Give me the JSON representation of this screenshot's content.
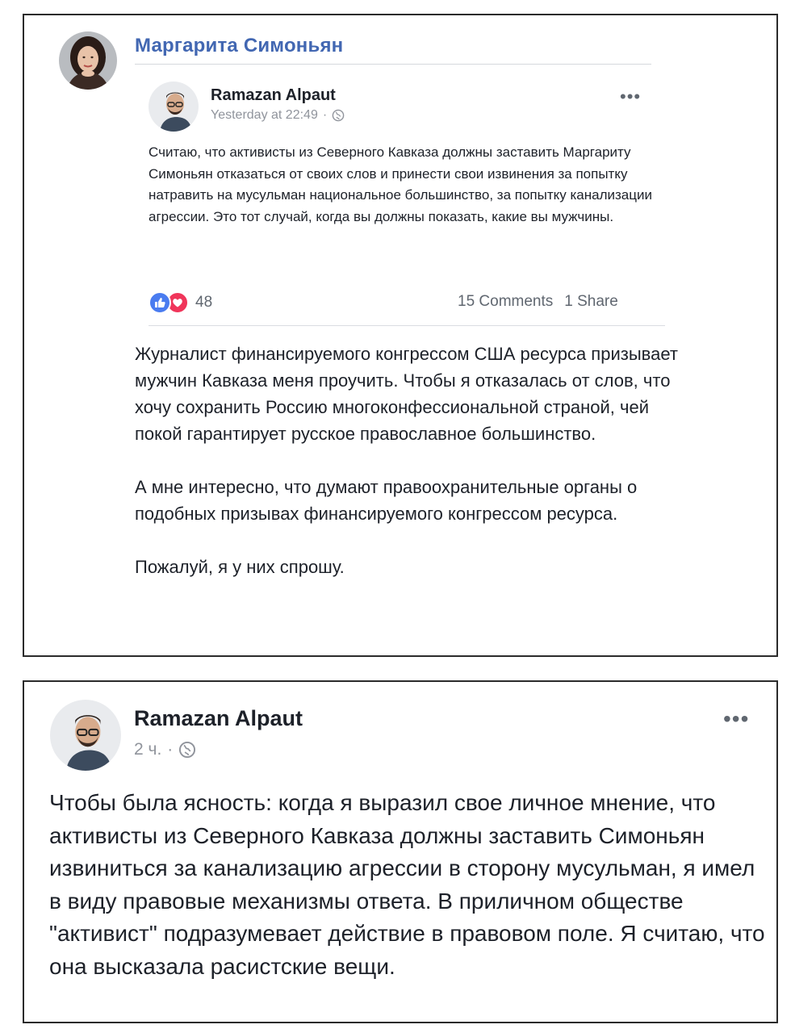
{
  "outer_post": {
    "author": "Маргарита Симоньян",
    "avatar_icon": "profile-photo-woman",
    "paragraphs": [
      "Журналист финансируемого конгрессом США ресурса призывает мужчин Кавказа меня проучить. Чтобы я отказалась от слов, что хочу сохранить Россию многоконфессиональной страной, чей покой гарантирует русское православное большинство.",
      "А мне интересно, что думают правоохранительные органы о подобных призывах финансируемого конгрессом ресурса.",
      "Пожалуй, я у них спрошу."
    ],
    "shared_post": {
      "author": "Ramazan Alpaut",
      "timestamp": "Yesterday at 22:49",
      "separator": "·",
      "privacy_icon": "globe-icon",
      "menu_label": "•••",
      "text": "Считаю, что активисты из Северного Кавказа должны заставить Маргариту Симоньян отказаться от своих слов и принести свои извинения за попытку натравить на мусульман национальное большинство, за попытку канализации агрессии. Это тот случай, когда вы должны показать, какие вы мужчины.",
      "reaction_count": "48",
      "comments": "15 Comments",
      "shares": "1 Share",
      "colors": {
        "like": "#4a7cf0",
        "love": "#f0355a"
      }
    }
  },
  "reply_post": {
    "author": "Ramazan Alpaut",
    "timestamp": "2 ч.",
    "separator": "·",
    "privacy_icon": "globe-icon",
    "menu_label": "•••",
    "text": "Чтобы была ясность: когда я выразил свое личное мнение, что активисты из Северного Кавказа должны заставить Симоньян извиниться за канализацию агрессии в сторону мусульман, я имел в виду правовые механизмы ответа. В приличном обществе \"активист\" подразумевает действие в правовом поле. Я считаю, что она высказала расистские вещи."
  },
  "colors": {
    "link": "#4267b2",
    "text": "#1d2129",
    "meta": "#90949c"
  }
}
